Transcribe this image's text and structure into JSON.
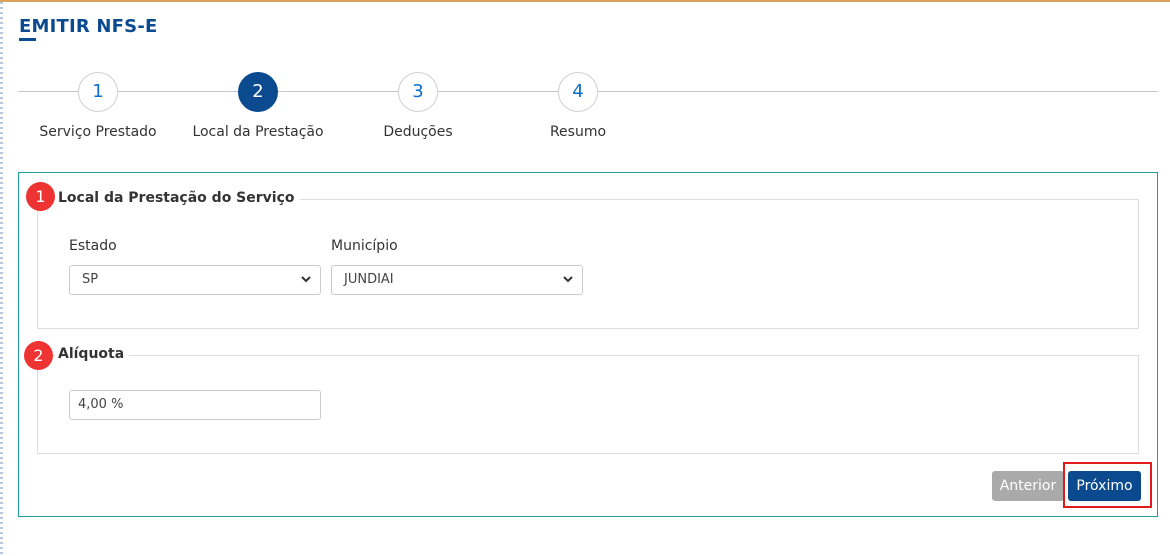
{
  "page": {
    "title": "EMITIR NFS-E"
  },
  "steps": [
    {
      "number": "1",
      "label": "Serviço Prestado"
    },
    {
      "number": "2",
      "label": "Local da Prestação"
    },
    {
      "number": "3",
      "label": "Deduções"
    },
    {
      "number": "4",
      "label": "Resumo"
    }
  ],
  "active_step": 2,
  "sections": {
    "local": {
      "badge": "1",
      "legend": "Local da Prestação do Serviço",
      "estado": {
        "label": "Estado",
        "value": "SP"
      },
      "municipio": {
        "label": "Município",
        "value": "JUNDIAI"
      }
    },
    "aliquota": {
      "badge": "2",
      "legend": "Alíquota",
      "value": "4,00 %"
    }
  },
  "buttons": {
    "previous": "Anterior",
    "next": "Próximo"
  },
  "colors": {
    "primary": "#0b4a8f",
    "step_number": "#0d6ecd",
    "panel_border": "#1f9b9b",
    "badge": "#ee3333",
    "highlight": "#e01b1b",
    "disabled_button": "#aaaaaa"
  },
  "icons": {
    "select_arrow": "chevron-down-icon"
  }
}
